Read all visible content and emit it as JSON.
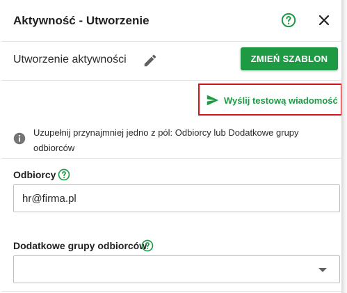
{
  "header": {
    "title": "Aktywność - Utworzenie"
  },
  "activity": {
    "name": "Utworzenie aktywności",
    "change_template_label": "ZMIEŃ SZABLON"
  },
  "test_message": {
    "label": "Wyślij testową wiadomość"
  },
  "info": {
    "text": "Uzupełnij przynajmniej jedno z pól: Odbiorcy lub Dodatkowe grupy odbiorców"
  },
  "recipients": {
    "label": "Odbiorcy",
    "value": "hr@firma.pl"
  },
  "additional_groups": {
    "label": "Dodatkowe grupy odbiorców",
    "value": ""
  },
  "colors": {
    "accent_green": "#1e9a45",
    "highlight_red": "#d0141b",
    "info_icon_gray": "#757575"
  },
  "icons": [
    "help-circle-icon",
    "close-icon",
    "pencil-icon",
    "send-icon",
    "info-icon",
    "chevron-down-icon"
  ]
}
